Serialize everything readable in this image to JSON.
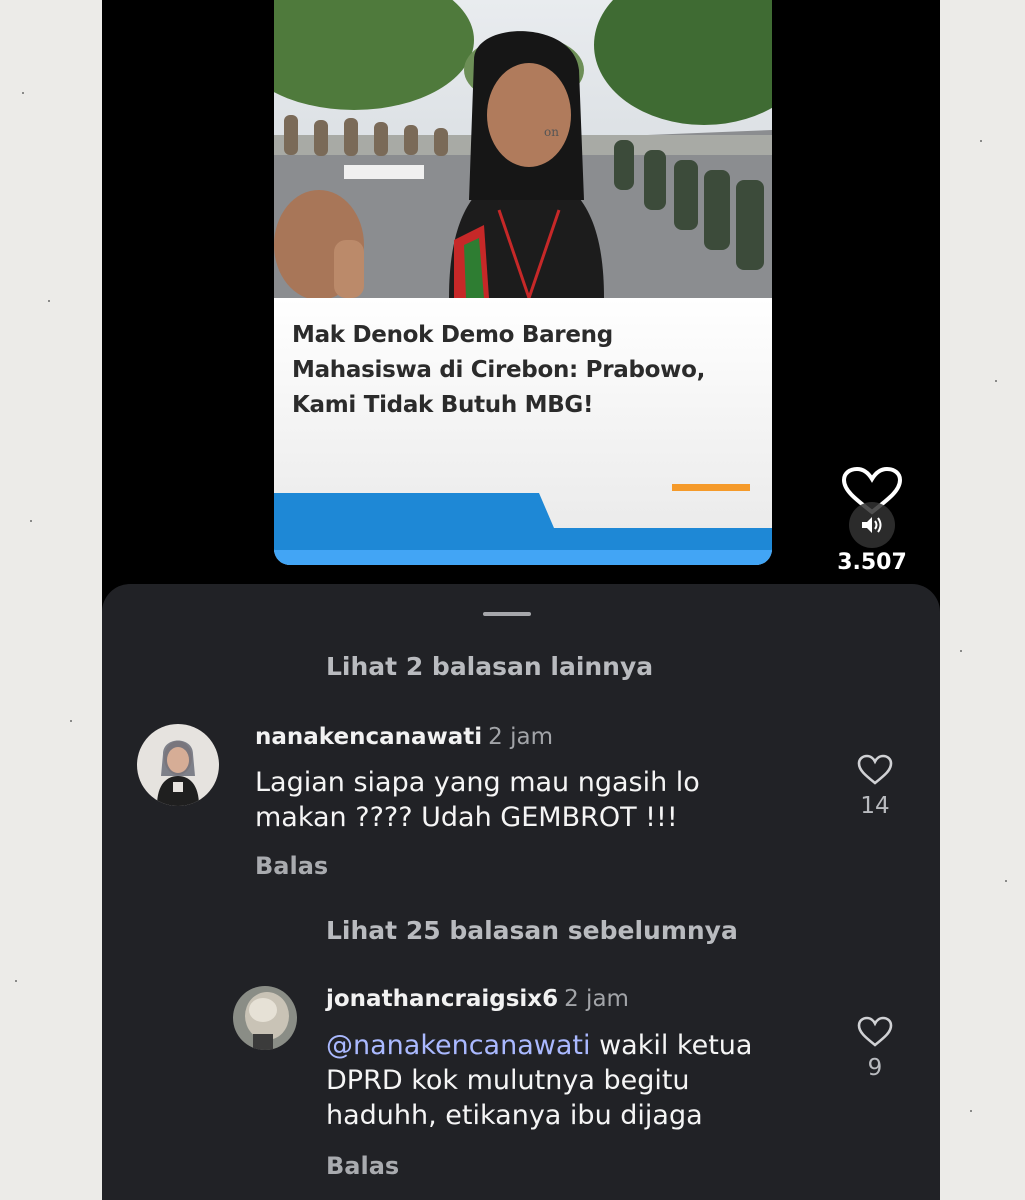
{
  "reel": {
    "headline": "Mak Denok Demo Bareng Mahasiswa di Cirebon: Prabowo, Kami Tidak Butuh MBG!",
    "watermark": "on",
    "like_count": "3.507"
  },
  "comments_sheet": {
    "view_more_top": "Lihat 2 balasan lainnya",
    "view_previous": "Lihat 25 balasan sebelumnya",
    "comments": [
      {
        "username": "nanakencanawati",
        "time": "2 jam",
        "text": "Lagian siapa yang mau ngasih lo makan ???? Udah GEMBROT !!!",
        "reply_label": "Balas",
        "likes": "14"
      },
      {
        "username": "jonathancraigsix6",
        "time": "2 jam",
        "mention": "@nanakencanawati",
        "text": "wakil ketua DPRD kok mulutnya begitu haduhh, etikanya ibu dijaga",
        "reply_label": "Balas",
        "likes": "9"
      }
    ]
  },
  "icons": [
    "heart-icon",
    "volume-icon",
    "heart-outline-icon"
  ],
  "colors": {
    "sheet_bg": "#212226",
    "phone_bg": "#000000",
    "mention": "#aab9ff",
    "banner_blue": "#1e88d6",
    "banner_orange": "#f59a2a"
  }
}
